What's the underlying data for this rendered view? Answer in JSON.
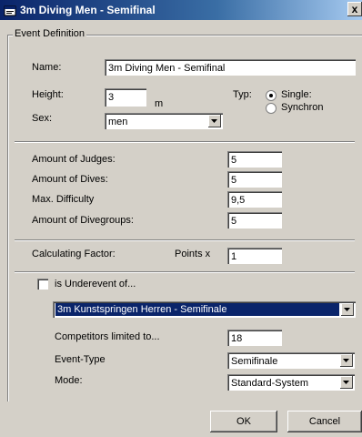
{
  "window": {
    "title": "3m Diving Men - Semifinal",
    "close_label": "x"
  },
  "event": {
    "group_label": "Event Definition",
    "name_label": "Name:",
    "name_value": "3m Diving Men - Semifinal",
    "height_label": "Height:",
    "height_value": "3",
    "height_unit": "m",
    "typ_label": "Typ:",
    "typ_options": [
      "Single:",
      "Synchron"
    ],
    "typ_selected": "Single:",
    "sex_label": "Sex:",
    "sex_value": "men",
    "judges_label": "Amount of Judges:",
    "judges_value": "5",
    "dives_label": "Amount of Dives:",
    "dives_value": "5",
    "difficulty_label": "Max. Difficulty",
    "difficulty_value": "9,5",
    "divegroups_label": "Amount of Divegroups:",
    "divegroups_value": "5",
    "factor_label": "Calculating Factor:",
    "points_label": "Points x",
    "factor_value": "1",
    "underevent_label": "is Underevent of...",
    "underevent_checked": false,
    "underevent_value": "3m Kunstspringen Herren - Semifinale",
    "competitors_label": "Competitors limited to...",
    "competitors_value": "18",
    "event_type_label": "Event-Type",
    "event_type_value": "Semifinale",
    "mode_label": "Mode:",
    "mode_value": "Standard-System"
  },
  "buttons": {
    "ok_label": "OK",
    "cancel_label": "Cancel"
  }
}
